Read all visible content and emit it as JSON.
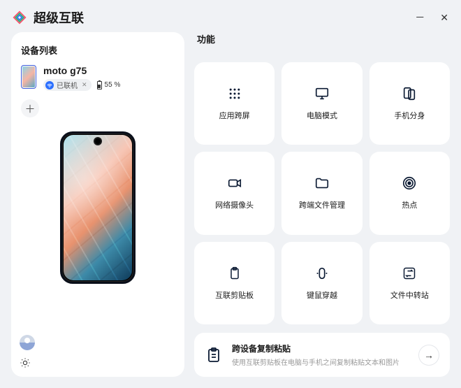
{
  "app": {
    "title": "超级互联"
  },
  "left": {
    "title": "设备列表",
    "device": {
      "name": "moto g75",
      "status": "已联机",
      "battery_text": "55 %"
    }
  },
  "right": {
    "title": "功能",
    "tiles": [
      {
        "label": "应用跨屏"
      },
      {
        "label": "电脑模式"
      },
      {
        "label": "手机分身"
      },
      {
        "label": "网络摄像头"
      },
      {
        "label": "跨端文件管理"
      },
      {
        "label": "热点"
      },
      {
        "label": "互联剪贴板"
      },
      {
        "label": "键鼠穿越"
      },
      {
        "label": "文件中转站"
      }
    ],
    "promo": {
      "title": "跨设备复制粘贴",
      "subtitle": "使用互联剪贴板在电脑与手机之间复制粘贴文本和图片"
    }
  }
}
